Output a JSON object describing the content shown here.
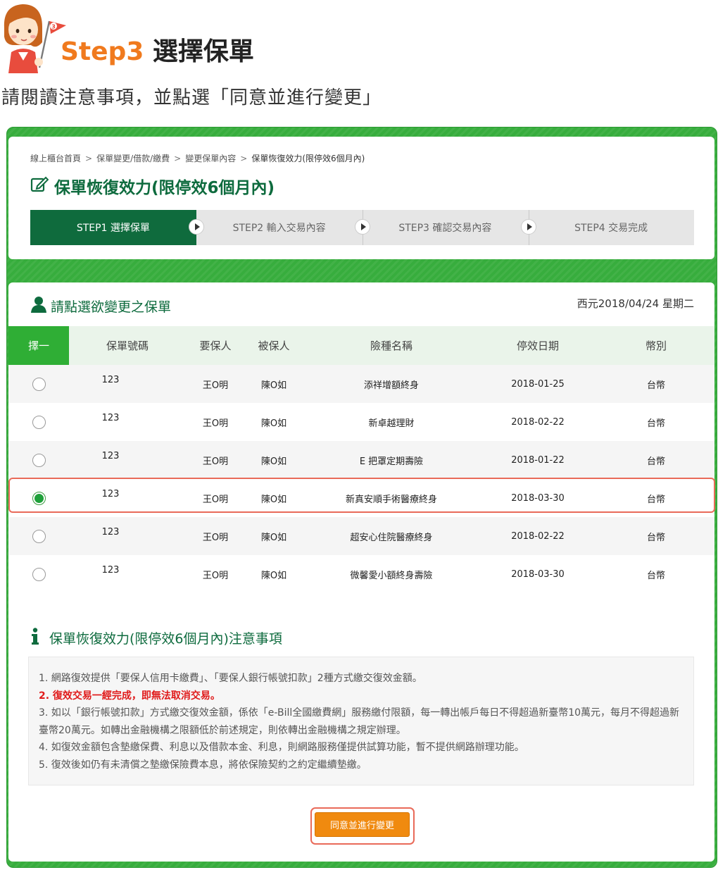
{
  "heading": {
    "step": "Step3",
    "title": "選擇保單",
    "flag_number": "3"
  },
  "instruction": "請閱讀注意事項，並點選「同意並進行變更」",
  "breadcrumb": [
    "線上櫃台首頁",
    "保單變更/借款/繳費",
    "變更保單內容",
    "保單恢復效力(限停效6個月內)"
  ],
  "breadcrumb_separator": ">",
  "page_title": "保單恢復效力(限停效6個月內)",
  "steps": [
    {
      "label": "STEP1 選擇保單",
      "active": true
    },
    {
      "label": "STEP2 輸入交易內容",
      "active": false
    },
    {
      "label": "STEP3 確認交易內容",
      "active": false
    },
    {
      "label": "STEP4 交易完成",
      "active": false
    }
  ],
  "section_title": "請點選欲變更之保單",
  "date": "西元2018/04/24 星期二",
  "table": {
    "headers": [
      "擇一",
      "保單號碼",
      "要保人",
      "被保人",
      "險種名稱",
      "停效日期",
      "幣別"
    ],
    "rows": [
      {
        "policy_no": "123",
        "applicant": "王O明",
        "insured": "陳O如",
        "product": "添祥增額終身",
        "date": "2018-01-25",
        "currency": "台幣",
        "selected": false
      },
      {
        "policy_no": "123",
        "applicant": "王O明",
        "insured": "陳O如",
        "product": "新卓越理財",
        "date": "2018-02-22",
        "currency": "台幣",
        "selected": false
      },
      {
        "policy_no": "123",
        "applicant": "王O明",
        "insured": "陳O如",
        "product": "E 把罩定期壽險",
        "date": "2018-01-22",
        "currency": "台幣",
        "selected": false
      },
      {
        "policy_no": "123",
        "applicant": "王O明",
        "insured": "陳O如",
        "product": "新真安順手術醫療終身",
        "date": "2018-03-30",
        "currency": "台幣",
        "selected": true
      },
      {
        "policy_no": "123",
        "applicant": "王O明",
        "insured": "陳O如",
        "product": "超安心住院醫療終身",
        "date": "2018-02-22",
        "currency": "台幣",
        "selected": false
      },
      {
        "policy_no": "123",
        "applicant": "王O明",
        "insured": "陳O如",
        "product": "微馨愛小額終身壽險",
        "date": "2018-03-30",
        "currency": "台幣",
        "selected": false
      }
    ]
  },
  "notice_title": "保單恢復效力(限停效6個月內)注意事項",
  "notices": [
    {
      "text": "1. 網路復效提供「要保人信用卡繳費」、「要保人銀行帳號扣款」2種方式繳交復效金額。",
      "highlight": false
    },
    {
      "text": "2. 復效交易一經完成，即無法取消交易。",
      "highlight": true
    },
    {
      "text": "3. 如以「銀行帳號扣款」方式繳交復效金額，係依「e-Bill全國繳費網」服務繳付限額，每一轉出帳戶每日不得超過新臺幣10萬元，每月不得超過新臺幣20萬元。如轉出金融機構之限額低於前述規定，則依轉出金融機構之規定辦理。",
      "highlight": false
    },
    {
      "text": "4. 如復效金額包含墊繳保費、利息以及借款本金、利息，則網路服務僅提供試算功能，暫不提供網路辦理功能。",
      "highlight": false
    },
    {
      "text": "5. 復效後如仍有未清償之墊繳保險費本息，將依保險契約之約定繼續墊繳。",
      "highlight": false
    }
  ],
  "submit_label": "同意並進行變更",
  "colors": {
    "brand_green": "#0f6b3d",
    "frame_green": "#37ad3d",
    "accent_orange": "#f08a0f",
    "step_orange": "#f07a1e",
    "highlight_red": "#e96a59"
  },
  "icons": {
    "mascot": "mascot-girl-with-flag",
    "title": "edit-icon",
    "section": "user-icon",
    "notice": "info-icon",
    "step_arrow": "play-arrow-icon"
  }
}
